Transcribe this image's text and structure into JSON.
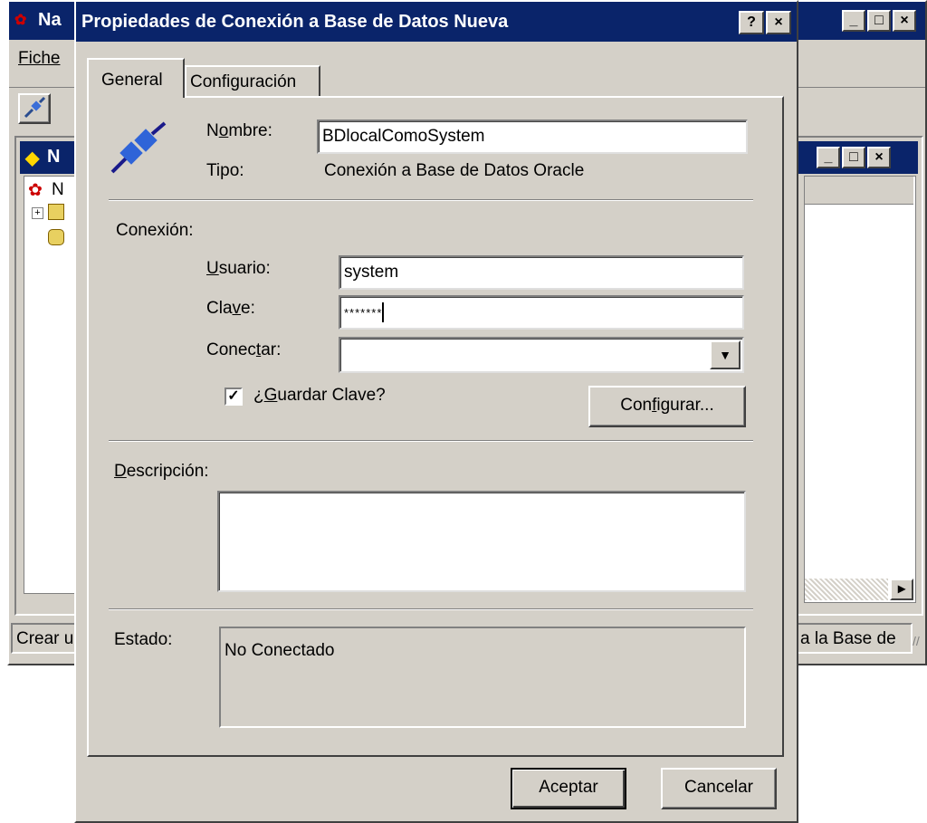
{
  "background_window": {
    "title": "Na",
    "menu_label": "Fiche",
    "tree_root_label": "N",
    "inner_window_title": "N",
    "statusbar_left": "Crear u",
    "statusbar_right": "a la Base de"
  },
  "dialog": {
    "title": "Propiedades de Conexión a Base de Datos Nueva",
    "help_btn": "?",
    "close_btn": "×",
    "tabs": [
      {
        "label": "General",
        "active": true
      },
      {
        "label": "Configuración",
        "active": false
      }
    ],
    "general": {
      "nombre_label": "Nombre:",
      "nombre_label_pre": "N",
      "nombre_label_u": "o",
      "nombre_label_post": "mbre:",
      "nombre_value": "BDlocalComoSystem",
      "tipo_label": "Tipo:",
      "tipo_value": "Conexión a Base de Datos Oracle",
      "conexion_heading": "Conexión:",
      "usuario_label_u": "U",
      "usuario_label_post": "suario:",
      "usuario_value": "system",
      "clave_label_pre": "Cla",
      "clave_label_u": "v",
      "clave_label_post": "e:",
      "clave_value": "*******",
      "conectar_label_pre": "Conec",
      "conectar_label_u": "t",
      "conectar_label_post": "ar:",
      "conectar_value": "",
      "guardar_checked": true,
      "guardar_label_pre": "¿",
      "guardar_label_u": "G",
      "guardar_label_post": "uardar Clave?",
      "configurar_pre": "Con",
      "configurar_u": "f",
      "configurar_post": "igurar...",
      "descripcion_label_u": "D",
      "descripcion_label_post": "escripción:",
      "descripcion_value": "",
      "estado_label": "Estado:",
      "estado_value": "No Conectado"
    },
    "buttons": {
      "accept": "Aceptar",
      "cancel": "Cancelar"
    }
  }
}
